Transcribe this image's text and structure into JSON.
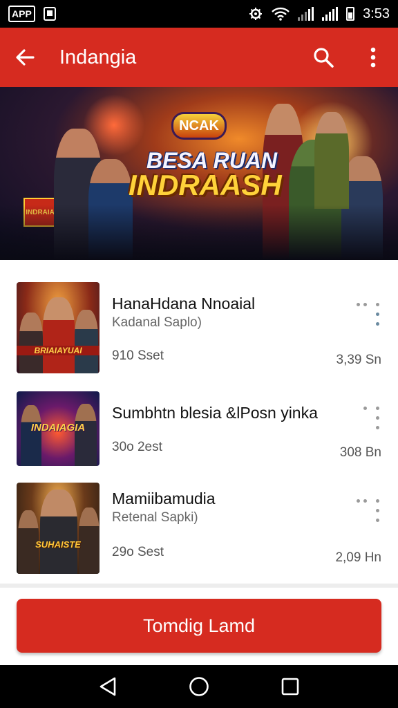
{
  "status_bar": {
    "app_badge": "APP",
    "time": "3:53",
    "icons": [
      "app-badge-icon",
      "download-icon",
      "alarm-icon",
      "wifi-icon",
      "signal-icon",
      "signal-icon",
      "battery-icon"
    ]
  },
  "app_bar": {
    "title": "Indangia",
    "back_icon": "arrow-left-icon",
    "search_icon": "search-icon",
    "menu_icon": "more-vertical-icon"
  },
  "hero": {
    "badge": "NCAK",
    "line1": "BESA RUAN",
    "line2": "INDRAASH",
    "left_sign": "INDRAIASH"
  },
  "items": [
    {
      "title": "HanaHdana Nnoaial",
      "subtitle": "Kadanal Saplo)",
      "meta": "910 Sset",
      "size": "3,39 Sn",
      "thumb_label": "BRIAIAYUAI"
    },
    {
      "title": "Sumbhtn blesia &lPosn yinka",
      "subtitle": "",
      "meta": "30o 2est",
      "size": "308 Bn",
      "thumb_label": "INDAIAGIA"
    },
    {
      "title": "Mamiibamudia",
      "subtitle": "Retenal Sapki)",
      "meta": "29o Sest",
      "size": "2,09 Hn",
      "thumb_label": "SUHAISTE"
    }
  ],
  "cta": {
    "label": "Tomdig Lamd"
  },
  "nav": {
    "back": "back-triangle-icon",
    "home": "home-circle-icon",
    "recents": "recents-square-icon"
  },
  "colors": {
    "brand_red": "#d62b20",
    "status_bg": "#000000"
  }
}
